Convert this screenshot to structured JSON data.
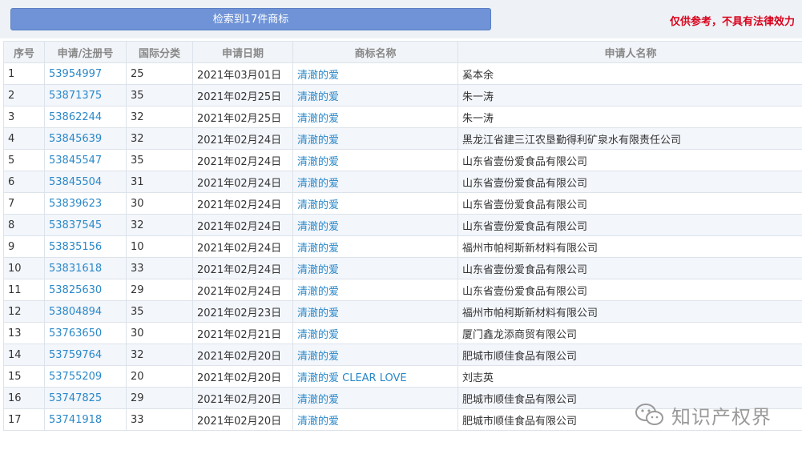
{
  "header": {
    "search_result_label": "检索到17件商标",
    "disclaimer": "仅供参考，不具有法律效力"
  },
  "table": {
    "columns": [
      "序号",
      "申请/注册号",
      "国际分类",
      "申请日期",
      "商标名称",
      "申请人名称"
    ],
    "rows": [
      {
        "index": "1",
        "reg_no": "53954997",
        "class": "25",
        "date": "2021年03月01日",
        "mark": "清澈的爱",
        "applicant": "奚本余"
      },
      {
        "index": "2",
        "reg_no": "53871375",
        "class": "35",
        "date": "2021年02月25日",
        "mark": "清澈的爱",
        "applicant": "朱一涛"
      },
      {
        "index": "3",
        "reg_no": "53862244",
        "class": "32",
        "date": "2021年02月25日",
        "mark": "清澈的爱",
        "applicant": "朱一涛"
      },
      {
        "index": "4",
        "reg_no": "53845639",
        "class": "32",
        "date": "2021年02月24日",
        "mark": "清澈的爱",
        "applicant": "黑龙江省建三江农垦勤得利矿泉水有限责任公司"
      },
      {
        "index": "5",
        "reg_no": "53845547",
        "class": "35",
        "date": "2021年02月24日",
        "mark": "清澈的爱",
        "applicant": "山东省壹份爱食品有限公司"
      },
      {
        "index": "6",
        "reg_no": "53845504",
        "class": "31",
        "date": "2021年02月24日",
        "mark": "清澈的爱",
        "applicant": "山东省壹份爱食品有限公司"
      },
      {
        "index": "7",
        "reg_no": "53839623",
        "class": "30",
        "date": "2021年02月24日",
        "mark": "清澈的爱",
        "applicant": "山东省壹份爱食品有限公司"
      },
      {
        "index": "8",
        "reg_no": "53837545",
        "class": "32",
        "date": "2021年02月24日",
        "mark": "清澈的爱",
        "applicant": "山东省壹份爱食品有限公司"
      },
      {
        "index": "9",
        "reg_no": "53835156",
        "class": "10",
        "date": "2021年02月24日",
        "mark": "清澈的爱",
        "applicant": "福州市帕柯斯新材料有限公司"
      },
      {
        "index": "10",
        "reg_no": "53831618",
        "class": "33",
        "date": "2021年02月24日",
        "mark": "清澈的爱",
        "applicant": "山东省壹份爱食品有限公司"
      },
      {
        "index": "11",
        "reg_no": "53825630",
        "class": "29",
        "date": "2021年02月24日",
        "mark": "清澈的爱",
        "applicant": "山东省壹份爱食品有限公司"
      },
      {
        "index": "12",
        "reg_no": "53804894",
        "class": "35",
        "date": "2021年02月23日",
        "mark": "清澈的爱",
        "applicant": "福州市帕柯斯新材料有限公司"
      },
      {
        "index": "13",
        "reg_no": "53763650",
        "class": "30",
        "date": "2021年02月21日",
        "mark": "清澈的爱",
        "applicant": "厦门鑫龙添商贸有限公司"
      },
      {
        "index": "14",
        "reg_no": "53759764",
        "class": "32",
        "date": "2021年02月20日",
        "mark": "清澈的爱",
        "applicant": "肥城市顺佳食品有限公司"
      },
      {
        "index": "15",
        "reg_no": "53755209",
        "class": "20",
        "date": "2021年02月20日",
        "mark": "清澈的爱 CLEAR LOVE",
        "applicant": "刘志英"
      },
      {
        "index": "16",
        "reg_no": "53747825",
        "class": "29",
        "date": "2021年02月20日",
        "mark": "清澈的爱",
        "applicant": "肥城市顺佳食品有限公司"
      },
      {
        "index": "17",
        "reg_no": "53741918",
        "class": "33",
        "date": "2021年02月20日",
        "mark": "清澈的爱",
        "applicant": "肥城市顺佳食品有限公司"
      }
    ]
  },
  "watermark": {
    "icon": "wechat-icon",
    "text": "知识产权界"
  }
}
